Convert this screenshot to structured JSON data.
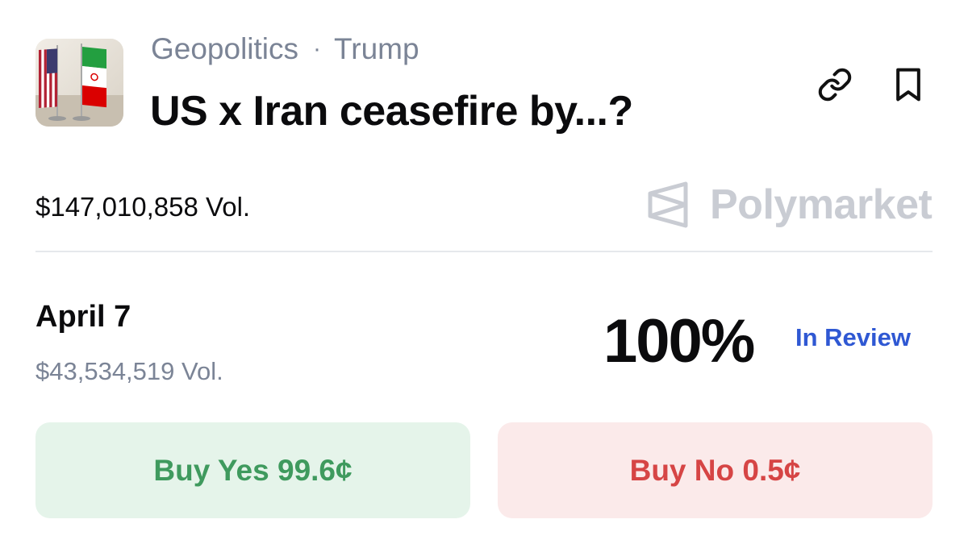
{
  "header": {
    "category": "Geopolitics",
    "separator": "·",
    "tag": "Trump",
    "title": "US x Iran ceasefire by...?"
  },
  "icons": {
    "thumbnail": "us-iran-flags-image",
    "link": "link-icon",
    "bookmark": "bookmark-icon",
    "brand_logo": "polymarket-logo-icon"
  },
  "market": {
    "total_volume": "$147,010,858 Vol.",
    "brand": "Polymarket"
  },
  "outcome": {
    "date": "April 7",
    "volume": "$43,534,519 Vol.",
    "probability": "100%",
    "status": "In Review"
  },
  "actions": {
    "buy_yes": "Buy Yes 99.6¢",
    "buy_no": "Buy No 0.5¢"
  },
  "colors": {
    "status_blue": "#2f58d3",
    "yes_green": "#3f9a5e",
    "yes_bg": "#e5f4ea",
    "no_red": "#d64545",
    "no_bg": "#fbeaea",
    "muted_gray": "#7b8496"
  }
}
